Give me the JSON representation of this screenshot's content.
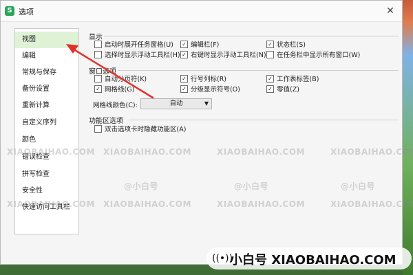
{
  "dialog": {
    "title": "选项",
    "app_icon": "S",
    "close_icon": "✕"
  },
  "sidebar": {
    "items": [
      {
        "label": "视图",
        "active": true
      },
      {
        "label": "编辑"
      },
      {
        "label": "常规与保存"
      },
      {
        "label": "备份设置"
      },
      {
        "label": "重新计算"
      },
      {
        "label": "自定义序列"
      },
      {
        "label": "颜色"
      },
      {
        "label": "错误检查"
      },
      {
        "label": "拼写检查"
      },
      {
        "label": "安全性"
      },
      {
        "label": "快速访问工具栏"
      }
    ]
  },
  "sections": {
    "display": {
      "title": "显示",
      "options": [
        {
          "label": "启动时展开任务窗格(U)",
          "checked": false
        },
        {
          "label": "编辑栏(F)",
          "checked": true
        },
        {
          "label": "状态栏(S)",
          "checked": true
        },
        {
          "label": "选择时显示浮动工具栏(H)",
          "checked": false
        },
        {
          "label": "右键时显示浮动工具栏(N)",
          "checked": true
        },
        {
          "label": "在任务栏中显示所有窗口(W)",
          "checked": false
        }
      ]
    },
    "window": {
      "title": "窗口选项",
      "options": [
        {
          "label": "自动分页符(K)",
          "checked": false
        },
        {
          "label": "行号列标(R)",
          "checked": true
        },
        {
          "label": "工作表标签(B)",
          "checked": true
        },
        {
          "label": "网格线(G)",
          "checked": true
        },
        {
          "label": "分级显示符号(O)",
          "checked": true
        },
        {
          "label": "零值(Z)",
          "checked": true
        }
      ],
      "grid_color_label": "网格线颜色(C):",
      "grid_color_value": "自动"
    },
    "ribbon": {
      "title": "功能区选项",
      "options": [
        {
          "label": "双击选项卡时隐藏功能区(A)",
          "checked": false
        }
      ]
    }
  },
  "watermark": {
    "small": "XIAOBAIHAO.COM",
    "small_cn": "@小白号",
    "big": "小白号 XIAOBAIHAO.COM"
  },
  "colors": {
    "active_bg": "#dff2d6",
    "arrow": "#e0322b"
  }
}
